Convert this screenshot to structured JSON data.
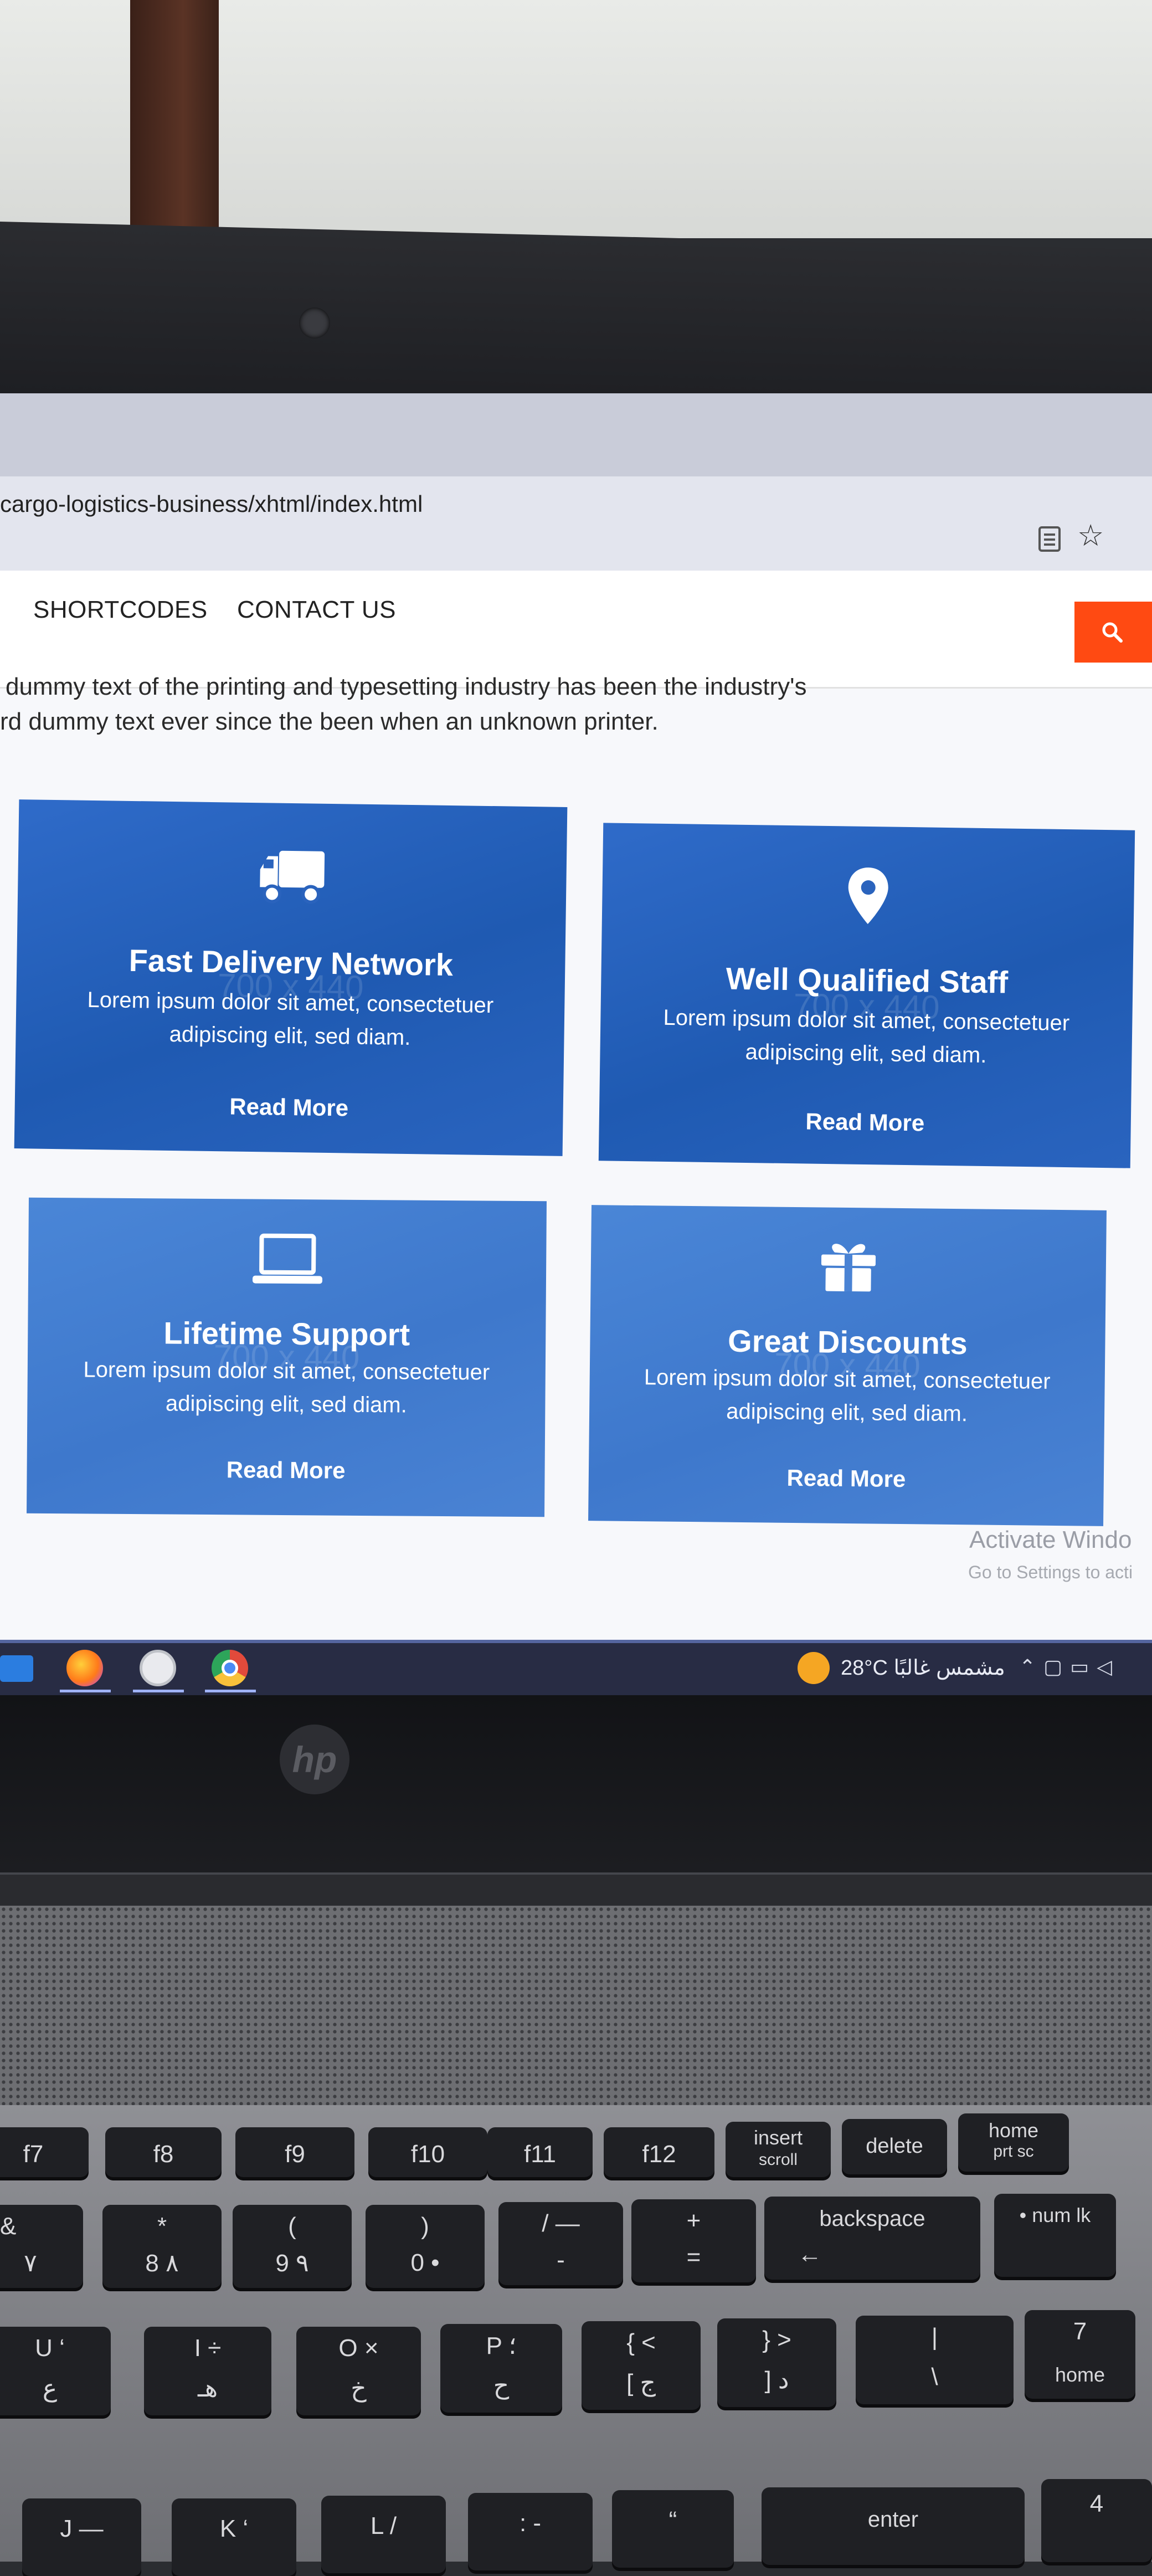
{
  "browser": {
    "url": "cargo-logistics-business/xhtml/index.html"
  },
  "nav": {
    "items": [
      {
        "label": "SHORTCODES"
      },
      {
        "label": "CONTACT US"
      }
    ],
    "search_icon": "search-icon",
    "accent_color": "#ff4a12"
  },
  "intro": {
    "line1": "dummy text of the printing and typesetting industry has been the industry's",
    "line2": "rd dummy text ever since the been when an unknown printer."
  },
  "cards": [
    {
      "icon": "truck-icon",
      "title": "Fast Delivery Network",
      "desc": "Lorem ipsum dolor sit amet, consectetuer adipiscing elit, sed diam.",
      "more": "Read More",
      "placeholder": "700 x 440"
    },
    {
      "icon": "map-pin-icon",
      "title": "Well Qualified Staff",
      "desc": "Lorem ipsum dolor sit amet, consectetuer adipiscing elit, sed diam.",
      "more": "Read More",
      "placeholder": "700 x 440"
    },
    {
      "icon": "laptop-icon",
      "title": "Lifetime Support",
      "desc": "Lorem ipsum dolor sit amet, consectetuer adipiscing elit, sed diam.",
      "more": "Read More",
      "placeholder": "700 x 440"
    },
    {
      "icon": "gift-icon",
      "title": "Great Discounts",
      "desc": "Lorem ipsum dolor sit amet, consectetuer adipiscing elit, sed diam.",
      "more": "Read More",
      "placeholder": "700 x 440"
    }
  ],
  "watermark": {
    "line1": "Activate Windo",
    "line2": "Go to Settings to acti"
  },
  "taskbar": {
    "apps": [
      "mail-icon",
      "firefox-icon",
      "whatsapp-icon",
      "chrome-icon"
    ],
    "weather": "28°C مشمس غالبًا"
  },
  "laptop": {
    "logo": "hp",
    "keys": {
      "f7": "f7",
      "f8": "f8",
      "f9": "f9",
      "f10": "f10",
      "f11": "f11",
      "f12": "f12",
      "insert": "insert",
      "scroll": "scroll",
      "delete": "delete",
      "home": "home",
      "prt_sc": "prt sc",
      "amp": "&",
      "seven": "٧",
      "star": "*",
      "eight": "8 ٨",
      "lparen": "(",
      "nine": "9 ٩",
      "rparen": ")",
      "zero": "0 •",
      "slash_dash": "/ —",
      "dash": "-",
      "plus": "+",
      "equals": "=",
      "backspace": "backspace",
      "back_arrow": "←",
      "num_lk": "• num lk",
      "u_key": "U ‘",
      "u_ar": "ع",
      "i_key": "I ÷",
      "i_ar": "هـ",
      "o_key": "O ×",
      "o_ar": "خ",
      "p_key": "P ؛",
      "p_ar": "ح",
      "brace_l": "{ <",
      "bracket_l": "[ ج",
      "brace_r": "} >",
      "bracket_r": "] د",
      "pipe": "|",
      "backslash": "\\",
      "num7": "7",
      "num7_home": "home",
      "j_key": "J —",
      "k_key": "K ‘",
      "l_key": "L /",
      "colon": ": -",
      "quote": "“",
      "enter": "enter",
      "num4": "4"
    }
  }
}
